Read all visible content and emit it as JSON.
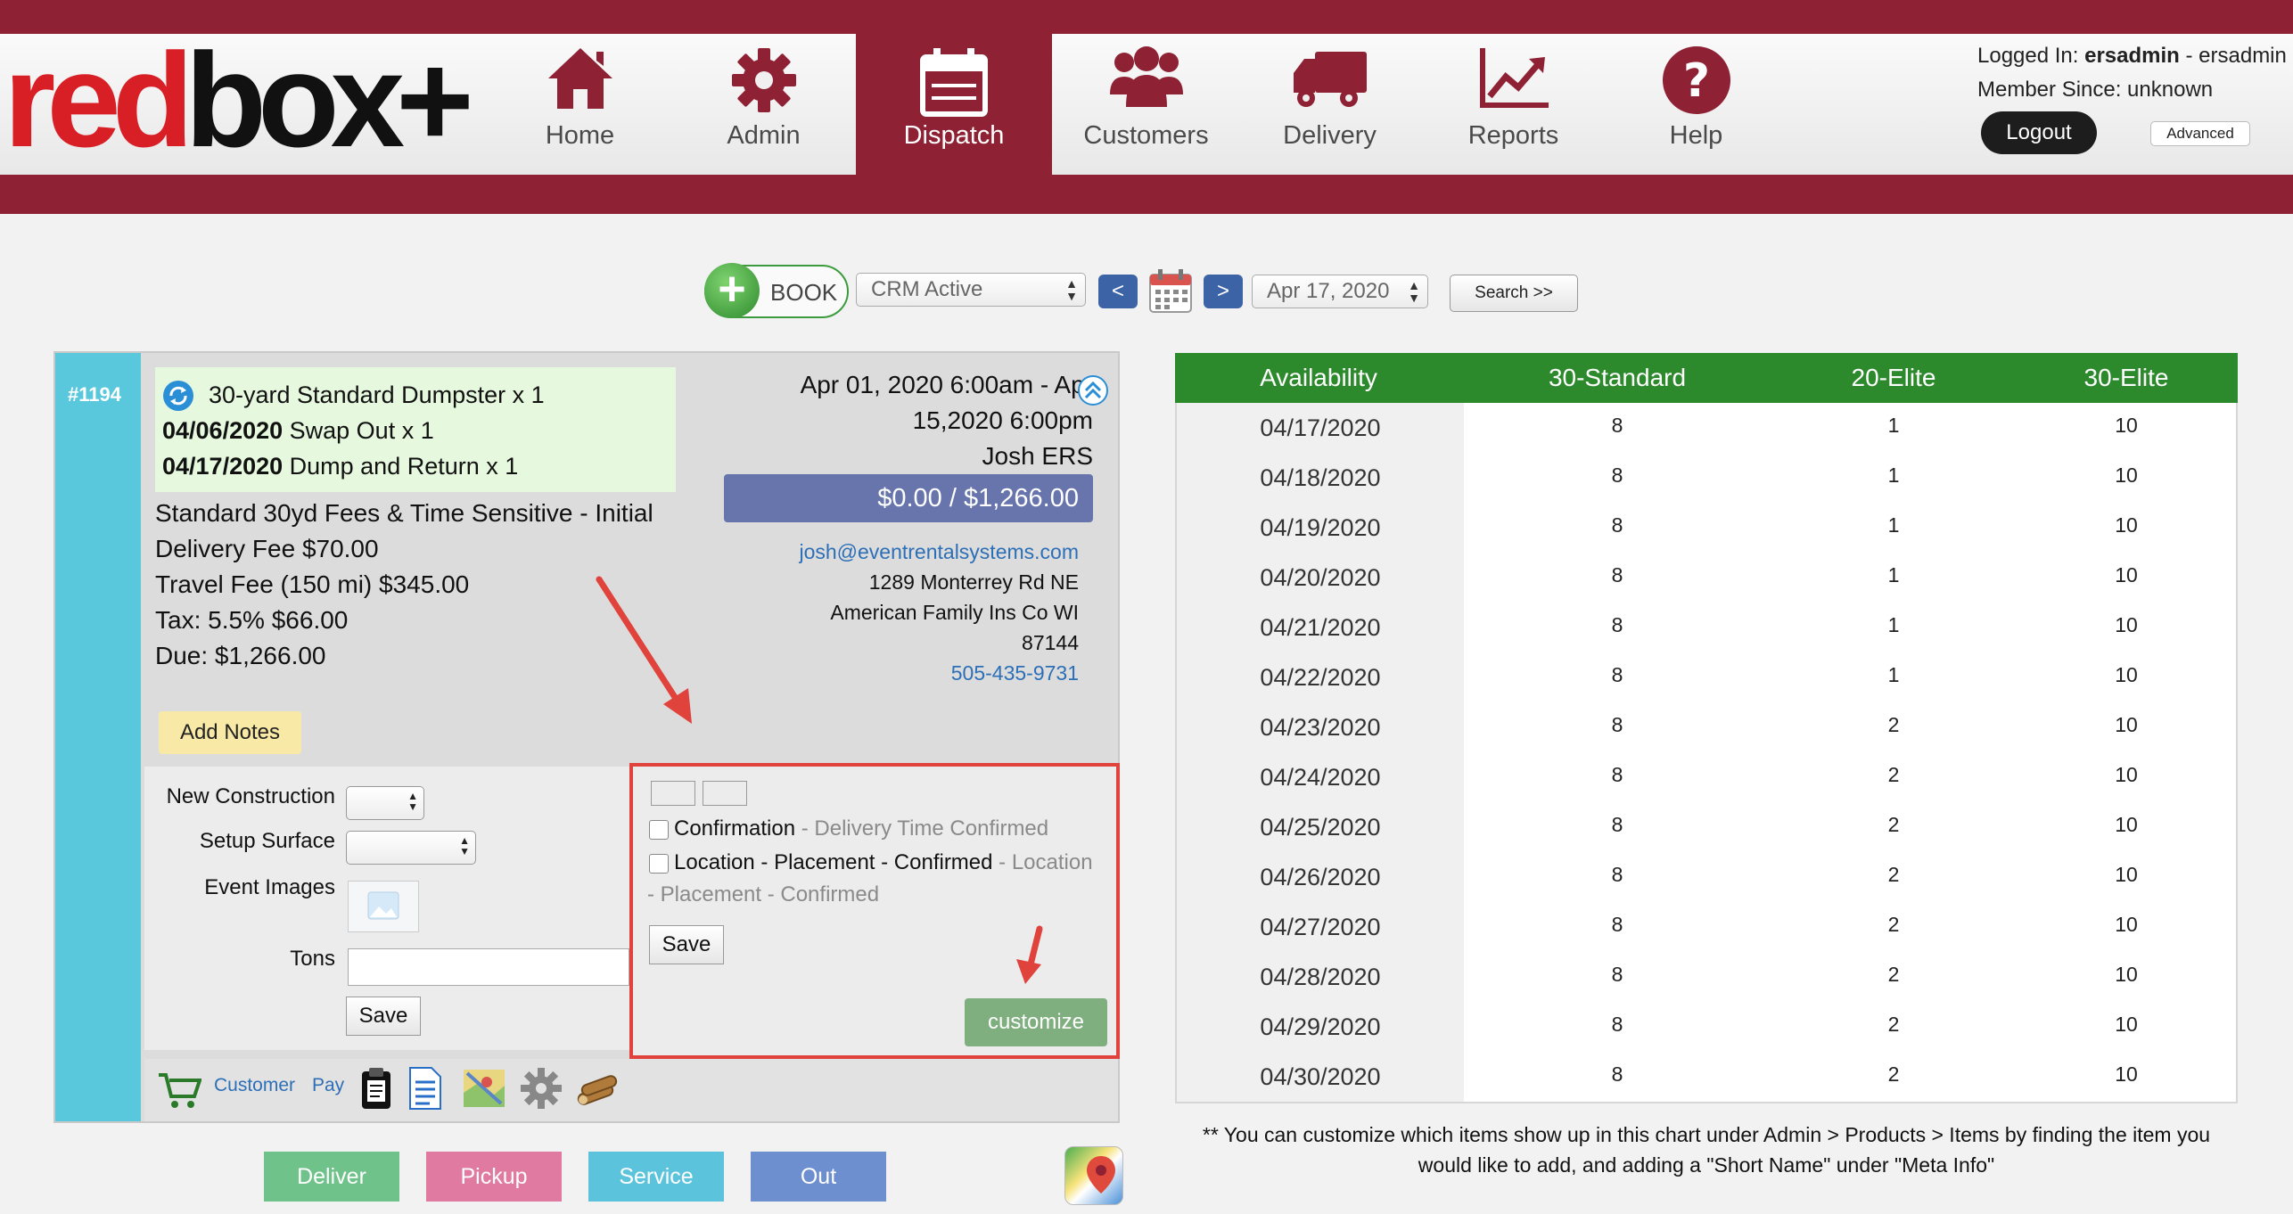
{
  "header": {
    "logo": {
      "red": "red",
      "black": "box+"
    },
    "nav": [
      {
        "label": "Home",
        "icon": "home-icon"
      },
      {
        "label": "Admin",
        "icon": "gear-icon"
      },
      {
        "label": "Dispatch",
        "icon": "calendar-icon",
        "active": true
      },
      {
        "label": "Customers",
        "icon": "users-icon"
      },
      {
        "label": "Delivery",
        "icon": "truck-icon"
      },
      {
        "label": "Reports",
        "icon": "chart-icon"
      },
      {
        "label": "Help",
        "icon": "help-icon"
      }
    ],
    "user": {
      "logged_in_prefix": "Logged In: ",
      "username": "ersadmin",
      "logged_in_suffix": " - ersadmin",
      "member_since": "Member Since: unknown"
    },
    "logout_label": "Logout",
    "advanced_label": "Advanced"
  },
  "toolbar": {
    "book_label": "BOOK",
    "filter_value": "CRM Active",
    "prev_label": "<",
    "next_label": ">",
    "date_value": "Apr 17, 2020",
    "search_label": "Search >>"
  },
  "order": {
    "id": "#1194",
    "item_main": "30-yard Standard Dumpster x 1",
    "events": [
      {
        "date": "04/06/2020",
        "desc": " Swap Out x 1"
      },
      {
        "date": "04/17/2020",
        "desc": " Dump and Return x 1"
      }
    ],
    "fees": [
      "Standard 30yd Fees & Time Sensitive - Initial",
      "Delivery Fee $70.00",
      "Travel Fee (150 mi) $345.00",
      "Tax: 5.5% $66.00",
      "Due: $1,266.00"
    ],
    "schedule_line1": "Apr 01, 2020 6:00am - Apr",
    "schedule_line2": "15,2020 6:00pm",
    "customer_name": "Josh ERS",
    "balance": "$0.00 / $1,266.00",
    "email": "josh@eventrentalsystems.com",
    "address1": "1289 Monterrey Rd NE",
    "address2": "American Family Ins Co WI",
    "zip": "87144",
    "phone": "505-435-9731",
    "add_notes_label": "Add Notes",
    "fields": {
      "new_construction_label": "New Construction",
      "setup_surface_label": "Setup Surface",
      "event_images_label": "Event Images",
      "tons_label": "Tons",
      "save_label": "Save"
    },
    "custom": {
      "cb1_label": "Confirmation",
      "cb1_sub": " - Delivery Time Confirmed",
      "cb2_label": "Location - Placement - Confirmed",
      "cb2_sub": " - Location",
      "cb2_sub2": "- Placement - Confirmed",
      "save_label": "Save",
      "customize_label": "customize"
    },
    "links": {
      "customer": "Customer",
      "pay": "Pay"
    },
    "actions": [
      {
        "label": "Deliver",
        "color": "#6fc28a"
      },
      {
        "label": "Pickup",
        "color": "#e07aa0"
      },
      {
        "label": "Service",
        "color": "#5bc3db"
      },
      {
        "label": "Out",
        "color": "#6e8fcf"
      }
    ]
  },
  "availability": {
    "headers": [
      "Availability",
      "30-Standard",
      "20-Elite",
      "30-Elite"
    ],
    "rows": [
      [
        "04/17/2020",
        "8",
        "1",
        "10"
      ],
      [
        "04/18/2020",
        "8",
        "1",
        "10"
      ],
      [
        "04/19/2020",
        "8",
        "1",
        "10"
      ],
      [
        "04/20/2020",
        "8",
        "1",
        "10"
      ],
      [
        "04/21/2020",
        "8",
        "1",
        "10"
      ],
      [
        "04/22/2020",
        "8",
        "1",
        "10"
      ],
      [
        "04/23/2020",
        "8",
        "2",
        "10"
      ],
      [
        "04/24/2020",
        "8",
        "2",
        "10"
      ],
      [
        "04/25/2020",
        "8",
        "2",
        "10"
      ],
      [
        "04/26/2020",
        "8",
        "2",
        "10"
      ],
      [
        "04/27/2020",
        "8",
        "2",
        "10"
      ],
      [
        "04/28/2020",
        "8",
        "2",
        "10"
      ],
      [
        "04/29/2020",
        "8",
        "2",
        "10"
      ],
      [
        "04/30/2020",
        "8",
        "2",
        "10"
      ]
    ],
    "note_line1": "** You can customize which items show up in this chart under Admin > Products > Items by finding the item you",
    "note_line2": "would like to add, and adding a \"Short Name\" under \"Meta Info\""
  },
  "colors": {
    "brand": "#8e2133",
    "accent_green": "#2c8a2c",
    "highlight_red": "#e0423c",
    "order_strip": "#59c7dc"
  }
}
